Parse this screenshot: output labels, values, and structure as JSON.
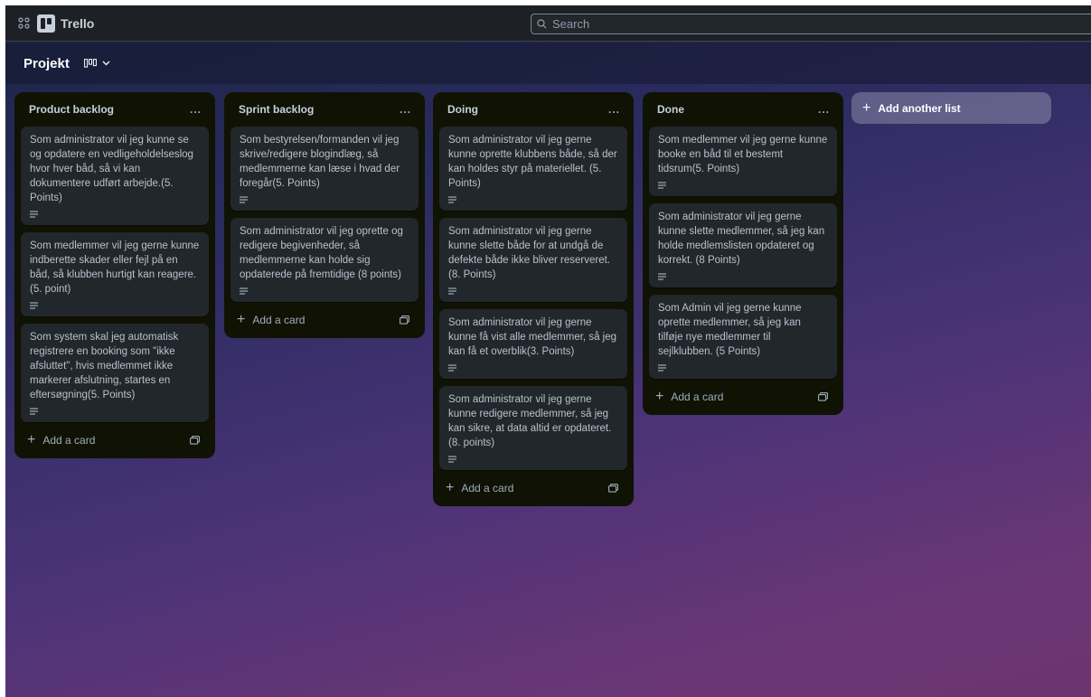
{
  "app": {
    "name": "Trello"
  },
  "search": {
    "placeholder": "Search"
  },
  "board": {
    "title": "Projekt"
  },
  "lists": [
    {
      "title": "Product backlog",
      "menu": "...",
      "add_label": "Add a card",
      "cards": [
        {
          "text": "Som administrator vil jeg kunne se og opdatere en vedligeholdelseslog hvor hver båd, så vi kan dokumentere udført arbejde.(5. Points)"
        },
        {
          "text": "Som medlemmer vil jeg gerne kunne indberette skader eller fejl på en båd, så klubben hurtigt kan reagere.(5. point)"
        },
        {
          "text": "Som system skal jeg automatisk registrere en booking som \"ikke afsluttet\", hvis medlemmet ikke markerer afslutning, startes en eftersøgning(5. Points)"
        }
      ]
    },
    {
      "title": "Sprint backlog",
      "menu": "...",
      "add_label": "Add a card",
      "cards": [
        {
          "text": "Som bestyrelsen/formanden vil jeg skrive/redigere blogindlæg, så medlemmerne kan læse i hvad der foregår(5. Points)"
        },
        {
          "text": "Som administrator vil jeg oprette og redigere begivenheder, så medlemmerne kan holde sig opdaterede på fremtidige (8 points)"
        }
      ]
    },
    {
      "title": "Doing",
      "menu": "...",
      "add_label": "Add a card",
      "cards": [
        {
          "text": "Som administrator vil jeg gerne kunne oprette klubbens både, så der kan holdes styr på materiellet. (5. Points)"
        },
        {
          "text": "Som administrator vil jeg gerne kunne slette både for at undgå de defekte både ikke bliver reserveret. (8. Points)"
        },
        {
          "text": "Som administrator vil jeg gerne kunne få vist alle medlemmer, så jeg kan få et overblik(3. Points)"
        },
        {
          "text": "Som administrator vil jeg gerne kunne redigere medlemmer, så jeg kan sikre, at data altid er opdateret. (8. points)"
        }
      ]
    },
    {
      "title": "Done",
      "menu": "...",
      "add_label": "Add a card",
      "cards": [
        {
          "text": "Som medlemmer vil jeg gerne kunne booke en båd til et bestemt tidsrum(5. Points)"
        },
        {
          "text": "Som administrator vil jeg gerne kunne slette medlemmer, så jeg kan holde medlemslisten opdateret og korrekt. (8 Points)"
        },
        {
          "text": "Som Admin vil jeg gerne kunne oprette medlemmer, så jeg kan tilføje nye medlemmer til sejlklubben. (5 Points)"
        }
      ]
    }
  ],
  "add_list": {
    "label": "Add another list"
  },
  "colors": {
    "list_bg": "#101204",
    "card_bg": "#22272b",
    "card_text": "#b6c2cf",
    "topbar_bg": "#1d2125"
  }
}
